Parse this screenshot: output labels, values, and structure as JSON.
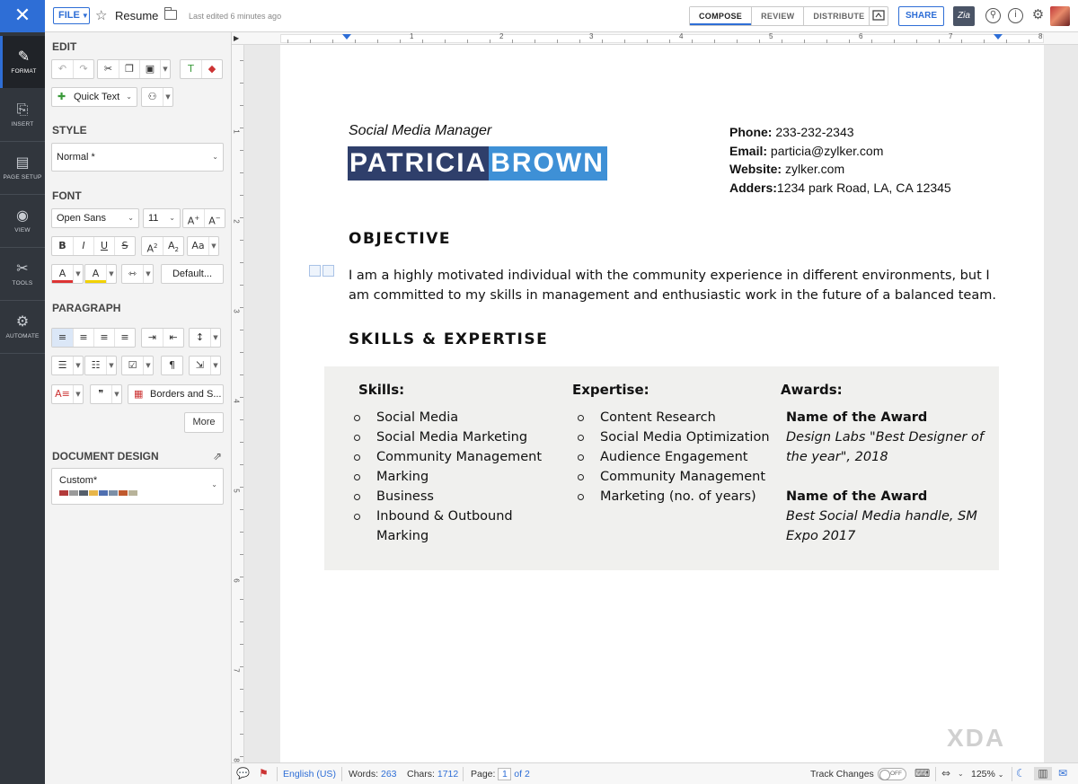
{
  "topbar": {
    "close_icon": "✕",
    "file_label": "FILE",
    "doc_name": "Resume",
    "last_edited": "Last edited 6 minutes ago",
    "tabs": [
      {
        "label": "COMPOSE",
        "active": true
      },
      {
        "label": "REVIEW",
        "active": false
      },
      {
        "label": "DISTRIBUTE",
        "active": false
      }
    ],
    "share_label": "SHARE",
    "zia_label": "Zia"
  },
  "nav": {
    "items": [
      {
        "label": "FORMAT",
        "icon": "pen-icon",
        "glyph": "✎"
      },
      {
        "label": "INSERT",
        "icon": "insert-icon",
        "glyph": "⎘"
      },
      {
        "label": "PAGE SETUP",
        "icon": "page-icon",
        "glyph": "▤"
      },
      {
        "label": "VIEW",
        "icon": "eye-icon",
        "glyph": "◉"
      },
      {
        "label": "TOOLS",
        "icon": "tools-icon",
        "glyph": "✂"
      },
      {
        "label": "AUTOMATE",
        "icon": "automate-icon",
        "glyph": "⚙"
      }
    ]
  },
  "panel": {
    "edit_title": "EDIT",
    "quick_text": "Quick Text",
    "style_title": "STYLE",
    "style_value": "Normal *",
    "font_title": "FONT",
    "font_family": "Open Sans",
    "font_size": "11",
    "default_label": "Default...",
    "paragraph_title": "PARAGRAPH",
    "borders_label": "Borders and S...",
    "more_label": "More",
    "design_title": "DOCUMENT DESIGN",
    "design_value": "Custom*",
    "swatch_colors": [
      "#b23a3a",
      "#9a9a9a",
      "#555f6b",
      "#e8b64a",
      "#4f6fb0",
      "#7c8fa6",
      "#c05a2e",
      "#b8b39a"
    ]
  },
  "ruler": {
    "top_numbers": [
      "1",
      "2",
      "3",
      "4",
      "5",
      "6",
      "7",
      "8"
    ],
    "left_numbers": [
      "1",
      "2",
      "3",
      "4",
      "5",
      "6",
      "7",
      "8"
    ]
  },
  "resume": {
    "job_title": "Social Media Manager",
    "first_name": "PATRICIA",
    "last_name": "BROWN",
    "contact": [
      {
        "label": "Phone:",
        "value": " 233-232-2343"
      },
      {
        "label": "Email:",
        "value": " particia@zylker.com"
      },
      {
        "label": "Website:",
        "value": " zylker.com"
      },
      {
        "label": "Adders:",
        "value": "1234 park Road, LA, CA 12345"
      }
    ],
    "objective_heading": "OBJECTIVE",
    "objective_text": "I am a highly motivated individual with the community experience in different environments, but I am committed to my skills in management and enthusiastic work in the future of a balanced team.",
    "skills_heading": "SKILLS & EXPERTISE",
    "skills_header": "Skills:",
    "skills": [
      "Social Media",
      "Social Media Marketing",
      "Community Management",
      "Marking",
      "Business",
      "Inbound & Outbound Marking"
    ],
    "expertise_header": "Expertise:",
    "expertise": [
      "Content Research",
      "Social Media Optimization",
      "Audience Engagement",
      "Community Management",
      "Marketing (no. of years)"
    ],
    "awards_header": "Awards:",
    "awards": [
      {
        "name": "Name of the Award",
        "desc": "Design Labs \"Best Designer of the year\", 2018"
      },
      {
        "name": "Name of the Award",
        "desc": "Best Social Media handle, SM Expo 2017"
      }
    ]
  },
  "status": {
    "language": "English (US)",
    "words_label": "Words:",
    "words": "263",
    "chars_label": "Chars:",
    "chars": "1712",
    "page_label": "Page:",
    "page_current": "1",
    "page_total": "of 2",
    "track_changes": "Track Changes",
    "track_state": "OFF",
    "zoom": "125%"
  },
  "watermark": "XDA"
}
